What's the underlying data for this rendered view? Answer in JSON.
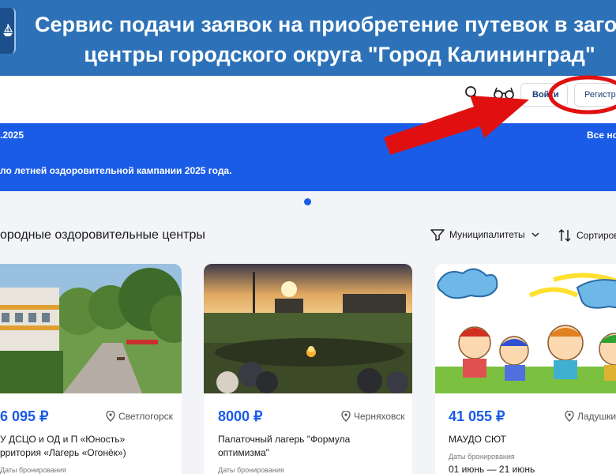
{
  "banner": {
    "title_line1": "Сервис подачи заявок на приобретение путевок в загородные",
    "title_line2": "центры городского округа \"Город Калининград\""
  },
  "header": {
    "login_label": "Войти",
    "register_label": "Регистрация"
  },
  "info_bar": {
    "date": ".2025",
    "all_news": "Все новости",
    "text": "ло летней оздоровительной кампании 2025 года."
  },
  "section": {
    "title": "ородные оздоровительные центры",
    "filter_label": "Муниципалитеты",
    "sort_label": "Сортировка"
  },
  "cards": [
    {
      "price": "6 095 ₽",
      "location": "Светлогорск",
      "name_line1": "У ДСЦО и ОД и П «Юность»",
      "name_line2": "рритория «Лагерь «Огонёк»)",
      "dates_label": "Даты бронирования",
      "dates": ""
    },
    {
      "price": "8000 ₽",
      "location": "Черняховск",
      "name_line1": "Палаточный лагерь \"Формула",
      "name_line2": "оптимизма\"",
      "dates_label": "Даты бронирования",
      "dates": ""
    },
    {
      "price": "41 055 ₽",
      "location": "Ладушкин",
      "name_line1": "МАУДО СЮТ",
      "name_line2": "",
      "dates_label": "Даты бронирования",
      "dates": "01 июнь — 21 июнь"
    }
  ],
  "colors": {
    "banner": "#2d72b8",
    "accent": "#1a5ce6",
    "annotation": "#e01010"
  },
  "icons": [
    "search-icon",
    "glasses-icon",
    "filter-icon",
    "chevron-down-icon",
    "sort-icon",
    "location-icon",
    "arrow-annotation",
    "circle-annotation"
  ]
}
